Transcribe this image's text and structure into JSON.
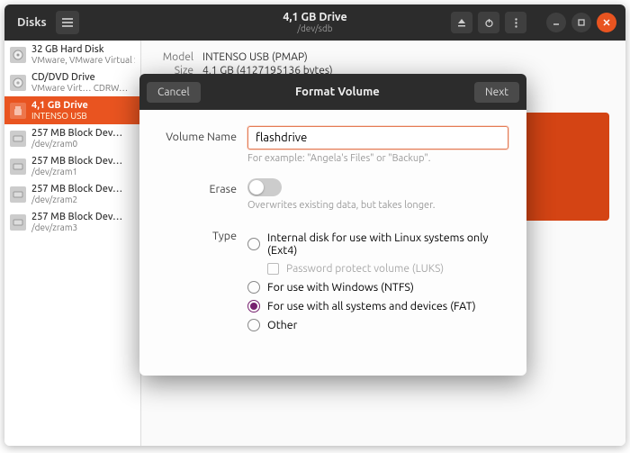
{
  "titlebar": {
    "app_name": "Disks",
    "drive_title": "4,1 GB Drive",
    "drive_path": "/dev/sdb"
  },
  "sidebar": {
    "devices": [
      {
        "title": "32 GB Hard Disk",
        "sub": "VMware, VMware Virtual S"
      },
      {
        "title": "CD/DVD Drive",
        "sub": "VMware Virt… CDRW…"
      },
      {
        "title": "4,1 GB Drive",
        "sub": "INTENSO USB"
      },
      {
        "title": "257 MB Block Dev…",
        "sub": "/dev/zram0"
      },
      {
        "title": "257 MB Block Dev…",
        "sub": "/dev/zram1"
      },
      {
        "title": "257 MB Block Dev…",
        "sub": "/dev/zram2"
      },
      {
        "title": "257 MB Block Dev…",
        "sub": "/dev/zram3"
      }
    ]
  },
  "details": {
    "model_label": "Model",
    "model_value": "INTENSO USB (PMAP)",
    "size_label": "Size",
    "size_value": "4,1 GB (4127195136 bytes)"
  },
  "modal": {
    "cancel": "Cancel",
    "title": "Format Volume",
    "next": "Next",
    "volume_name_label": "Volume Name",
    "volume_name_value": "flashdrive",
    "volume_name_hint": "For example: \"Angela's Files\" or \"Backup\".",
    "erase_label": "Erase",
    "erase_hint": "Overwrites existing data, but takes longer.",
    "type_label": "Type",
    "opt_ext4": "Internal disk for use with Linux systems only (Ext4)",
    "opt_luks": "Password protect volume (LUKS)",
    "opt_ntfs": "For use with Windows (NTFS)",
    "opt_fat": "For use with all systems and devices (FAT)",
    "opt_other": "Other"
  }
}
